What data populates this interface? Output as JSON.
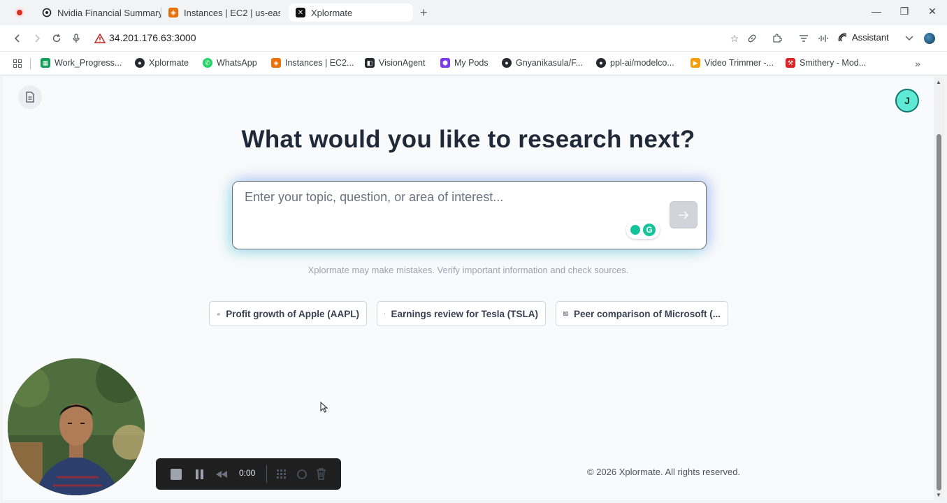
{
  "browser": {
    "tabs": [
      {
        "title": "Nvidia Financial Summary",
        "icon": "openai-icon"
      },
      {
        "title": "Instances | EC2 | us-east",
        "icon": "aws-icon"
      },
      {
        "title": "Xplormate",
        "icon": "x-icon",
        "active": true
      }
    ],
    "url": "34.201.176.63:3000",
    "assistant_label": "Assistant"
  },
  "bookmarks": [
    {
      "label": "Work_Progress...",
      "icon": "sheets-icon",
      "color": "#0f9d58"
    },
    {
      "label": "Xplormate",
      "icon": "github-icon",
      "color": "#24292f"
    },
    {
      "label": "WhatsApp",
      "icon": "whatsapp-icon",
      "color": "#25d366"
    },
    {
      "label": "Instances | EC2...",
      "icon": "aws-icon",
      "color": "#e8710a"
    },
    {
      "label": "VisionAgent",
      "icon": "visionagent-icon",
      "color": "#24292f"
    },
    {
      "label": "My Pods",
      "icon": "cube-icon",
      "color": "#7c3aed"
    },
    {
      "label": "Gnyanikasula/F...",
      "icon": "github-icon",
      "color": "#24292f"
    },
    {
      "label": "ppl-ai/modelco...",
      "icon": "github-icon",
      "color": "#24292f"
    },
    {
      "label": "Video Trimmer -...",
      "icon": "video-icon",
      "color": "#f59e0b"
    },
    {
      "label": "Smithery - Mod...",
      "icon": "smithery-icon",
      "color": "#dc2626"
    }
  ],
  "page": {
    "avatar_initial": "J",
    "headline": "What would you like to research next?",
    "search_placeholder": "Enter your topic, question, or area of interest...",
    "submit_icon": "arrow-right-icon",
    "disclaimer": "Xplormate may make mistakes. Verify important information and check sources.",
    "suggestions": [
      {
        "label": "Profit growth of Apple (AAPL)",
        "icon": "chart-icon"
      },
      {
        "label": "Earnings review for Tesla (TSLA)",
        "icon": "newspaper-icon"
      },
      {
        "label": "Peer comparison of Microsoft (...",
        "icon": "newspaper-icon"
      }
    ],
    "footer": "© 2026 Xplormate. All rights reserved."
  },
  "recorder": {
    "time": "0:00"
  }
}
